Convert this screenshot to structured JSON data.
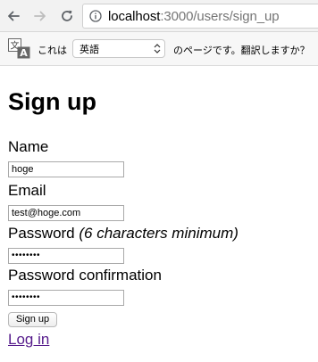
{
  "browser": {
    "url_host": "localhost",
    "url_path": ":3000/users/sign_up"
  },
  "translate_bar": {
    "prefix": "これは",
    "language": "英語",
    "suffix": "のページです。翻訳しますか？"
  },
  "page": {
    "title": "Sign up",
    "fields": [
      {
        "label": "Name",
        "value": "hoge"
      },
      {
        "label": "Email",
        "value": "test@hoge.com"
      },
      {
        "label": "Password",
        "hint": "(6 characters minimum)",
        "value": "••••••••"
      },
      {
        "label": "Password confirmation",
        "value": "••••••••"
      }
    ],
    "submit_label": "Sign up",
    "login_link": "Log in"
  }
}
